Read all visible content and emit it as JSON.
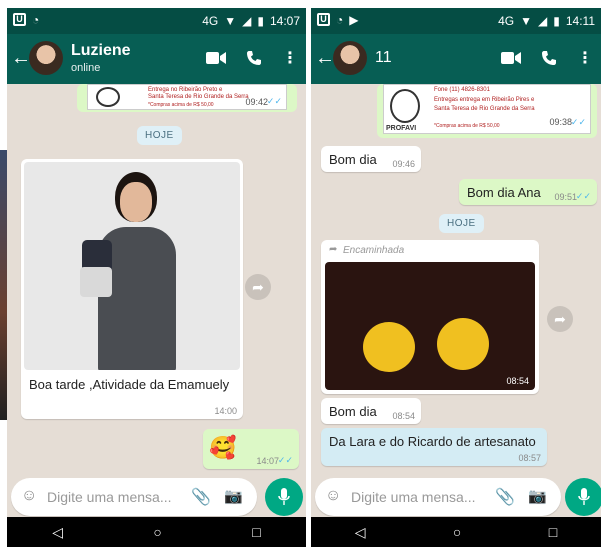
{
  "left": {
    "status": {
      "time": "14:07",
      "net": "4G"
    },
    "contact": {
      "name": "Luziene",
      "status": "online"
    },
    "top_msg": {
      "time": "09:42",
      "line1": "Entrega no Ribeirão Preto e",
      "line2": "Santa Teresa de Rio Grande da Serra",
      "line3": "*Compras acima de R$ 50,00"
    },
    "date_chip": "HOJE",
    "photo_msg": {
      "caption": "Boa tarde ,Atividade da Emamuely",
      "time": "14:00"
    },
    "emoji_msg": {
      "emoji": "🥰",
      "time": "14:07"
    },
    "input": {
      "placeholder": "Digite uma mensa..."
    }
  },
  "right": {
    "status": {
      "time": "14:11",
      "net": "4G"
    },
    "contact": {
      "name": "11"
    },
    "top_msg": {
      "time": "09:38",
      "brand": "PROFAVI",
      "phone": "Fone (11) 4826-8301",
      "line1": "Entregas entrega em Ribeirão Pires e",
      "line2": "Santa Teresa de Rio Grande da Serra",
      "line3": "*Compras acima de R$ 50,00"
    },
    "msg1": {
      "text": "Bom dia",
      "time": "09:46"
    },
    "msg2": {
      "text": "Bom dia Ana",
      "time": "09:51"
    },
    "date_chip": "HOJE",
    "forward": {
      "label": "Encaminhada",
      "time": "08:54"
    },
    "msg3": {
      "text": "Bom dia",
      "time": "08:54"
    },
    "msg4": {
      "text": "Da Lara e do Ricardo de artesanato",
      "time": "08:57"
    },
    "input": {
      "placeholder": "Digite uma mensa..."
    }
  },
  "nav": {
    "back": "◁",
    "home": "○",
    "recent": "□"
  }
}
